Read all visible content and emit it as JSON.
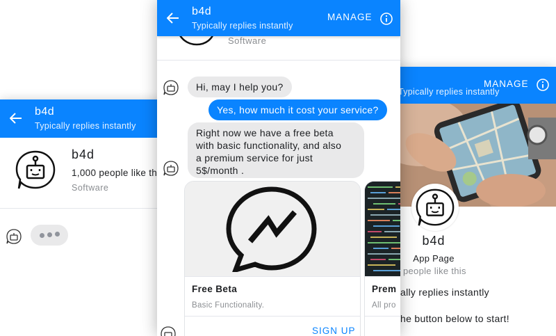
{
  "left": {
    "header": {
      "title": "b4d",
      "subtitle": "Typically replies instantly"
    },
    "page": {
      "name": "b4d",
      "likes": "1,000 people like th",
      "category": "Software"
    }
  },
  "center": {
    "header": {
      "title": "b4d",
      "subtitle": "Typically replies instantly",
      "manage": "MANAGE"
    },
    "page_category": "Software",
    "messages": [
      {
        "from": "bot",
        "lines": [
          "Hi, may I help you?"
        ]
      },
      {
        "from": "user",
        "lines": [
          "Yes, how much it cost your service?"
        ]
      },
      {
        "from": "bot",
        "lines": [
          "Right now we have a free beta",
          "with basic functionality, and also",
          "a premium service for just",
          "5$/month ."
        ]
      }
    ],
    "cards": [
      {
        "title": "Free Beta",
        "subtitle": "Basic Functionality.",
        "button": "SIGN UP"
      },
      {
        "title": "Prem",
        "subtitle": "All pro"
      }
    ]
  },
  "right": {
    "header": {
      "subtitle": "Typically replies instantly",
      "manage": "MANAGE"
    },
    "page": {
      "name": "b4d",
      "type": "App Page",
      "likes": "people like this"
    },
    "reply_note": "ally replies instantly",
    "start_note": "he button below to start!"
  },
  "colors": {
    "accent": "#0a84ff",
    "bubble_in": "#e9e9ea"
  },
  "icons": [
    "back-arrow-icon",
    "info-icon",
    "bot-logo-icon",
    "messenger-logo-icon"
  ]
}
